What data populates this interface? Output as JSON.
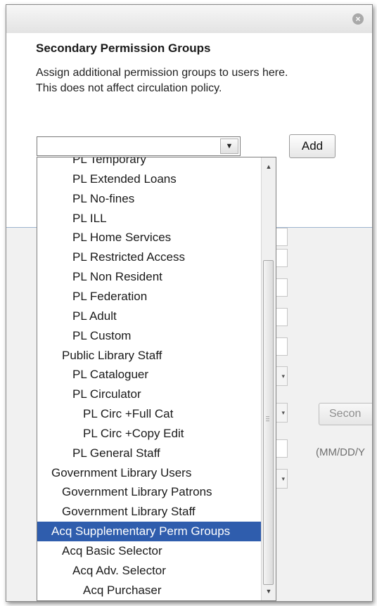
{
  "dialog": {
    "close_glyph": "×",
    "heading": "Secondary Permission Groups",
    "description_line1": "Assign additional permission groups to users here.",
    "description_line2": "This does not affect circulation policy.",
    "select_value": "",
    "select_arrow": "▼",
    "add_label": "Add"
  },
  "background_form": {
    "second_button_label": "Secon",
    "date_hint": "(MM/DD/Y"
  },
  "dropdown": {
    "scroll_up": "▲",
    "scroll_down": "▼",
    "items": [
      {
        "label": "PL Temporary",
        "indent": 2
      },
      {
        "label": "PL Extended Loans",
        "indent": 2
      },
      {
        "label": "PL No-fines",
        "indent": 2
      },
      {
        "label": "PL ILL",
        "indent": 2
      },
      {
        "label": "PL Home Services",
        "indent": 2
      },
      {
        "label": "PL Restricted Access",
        "indent": 2
      },
      {
        "label": "PL Non Resident",
        "indent": 2
      },
      {
        "label": "PL Federation",
        "indent": 2
      },
      {
        "label": "PL Adult",
        "indent": 2
      },
      {
        "label": "PL Custom",
        "indent": 2
      },
      {
        "label": "Public Library Staff",
        "indent": 1
      },
      {
        "label": "PL Cataloguer",
        "indent": 2
      },
      {
        "label": "PL Circulator",
        "indent": 2
      },
      {
        "label": "PL Circ +Full Cat",
        "indent": 3
      },
      {
        "label": "PL Circ +Copy Edit",
        "indent": 3
      },
      {
        "label": "PL General Staff",
        "indent": 2
      },
      {
        "label": "Government Library Users",
        "indent": 0
      },
      {
        "label": "Government Library Patrons",
        "indent": 1
      },
      {
        "label": "Government Library Staff",
        "indent": 1
      },
      {
        "label": "Acq Supplementary Perm Groups",
        "indent": 0,
        "selected": true
      },
      {
        "label": "Acq Basic Selector",
        "indent": 1
      },
      {
        "label": "Acq Adv. Selector",
        "indent": 2
      },
      {
        "label": "Acq Purchaser",
        "indent": 3
      }
    ]
  }
}
